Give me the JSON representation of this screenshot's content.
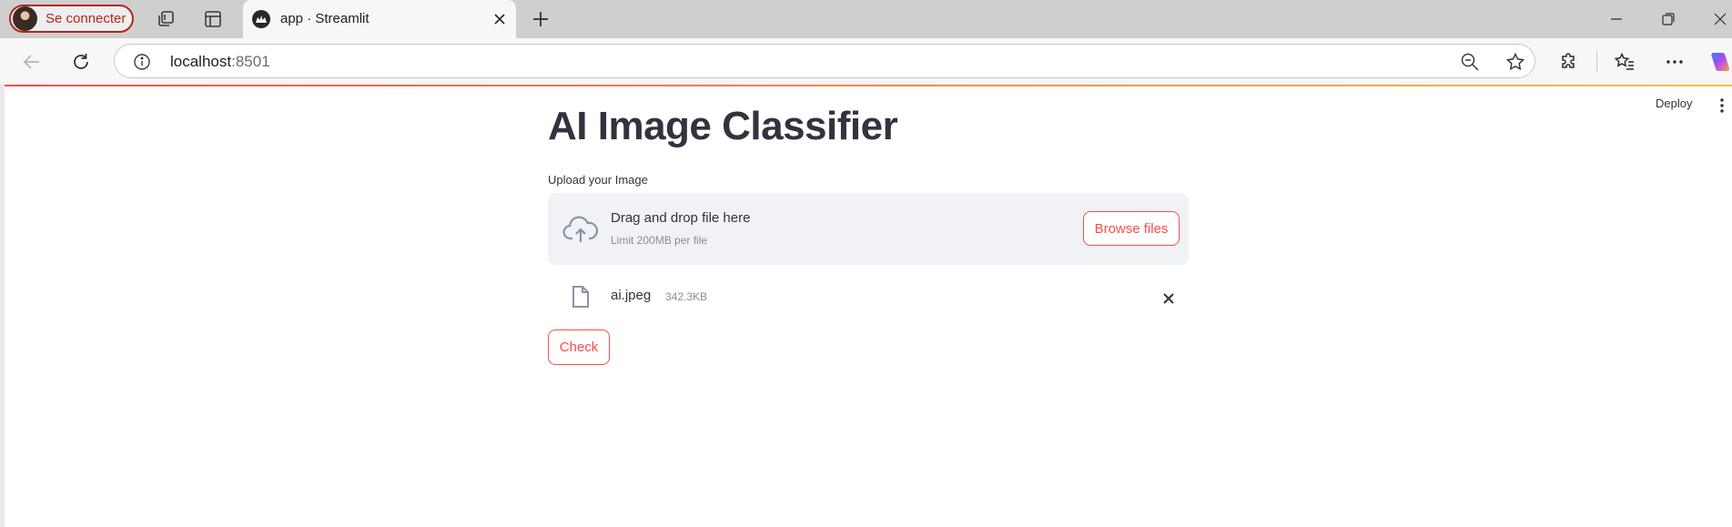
{
  "browser": {
    "profile_label": "Se connecter",
    "tab": {
      "title": "app · Streamlit"
    },
    "url": {
      "host": "localhost",
      "port": ":8501"
    },
    "icons": {
      "workspaces": "workspaces-icon",
      "tab_actions": "tab-actions-icon",
      "new_tab": "plus-icon",
      "back": "arrow-left-icon",
      "refresh": "refresh-icon",
      "site_info": "info-icon",
      "zoom": "zoom-out-icon",
      "favorite": "star-icon",
      "extensions": "puzzle-icon",
      "favorites": "favorites-icon",
      "more": "ellipsis-icon",
      "copilot": "copilot-icon"
    }
  },
  "app": {
    "toolbar": {
      "deploy_label": "Deploy"
    },
    "title": "AI Image Classifier",
    "uploader": {
      "label": "Upload your Image",
      "drop_title": "Drag and drop file here",
      "limit": "Limit 200MB per file",
      "browse_label": "Browse files"
    },
    "file": {
      "name": "ai.jpeg",
      "size": "342.3KB"
    },
    "check_label": "Check"
  },
  "colors": {
    "accent": "#ff4b4b",
    "text": "#31333f",
    "dropzone_bg": "#f0f2f6",
    "profile_border": "#b3261e"
  }
}
